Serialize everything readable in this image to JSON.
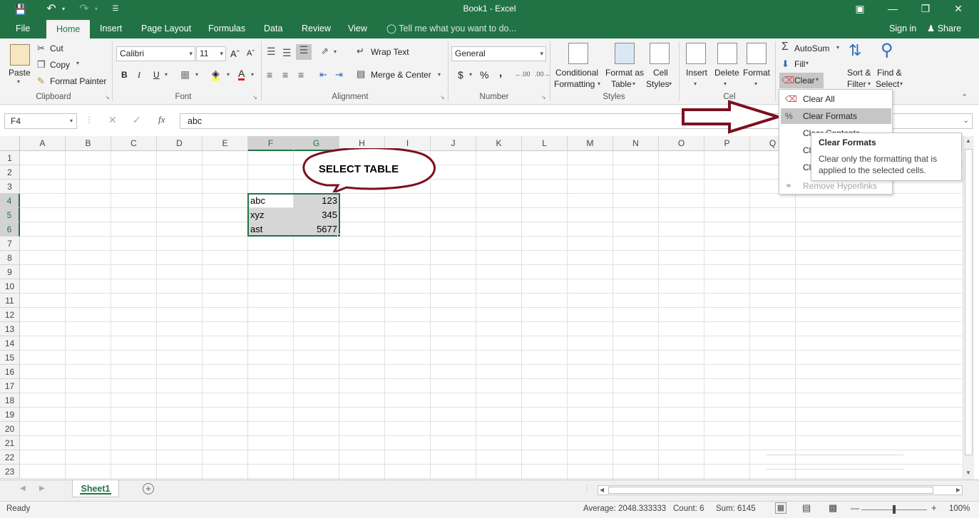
{
  "window": {
    "title": "Book1  -  Excel",
    "undo_icon": "undo-icon",
    "redo_icon": "redo-icon",
    "save_icon": "save-icon"
  },
  "tabs": [
    "File",
    "Home",
    "Insert",
    "Page Layout",
    "Formulas",
    "Data",
    "Review",
    "View"
  ],
  "active_tab": "Home",
  "tell_me": "Tell me what you want to do...",
  "account": {
    "sign_in": "Sign in",
    "share": "Share"
  },
  "ribbon": {
    "clipboard": {
      "paste": "Paste",
      "cut": "Cut",
      "copy": "Copy",
      "format_painter": "Format Painter",
      "label": "Clipboard"
    },
    "font": {
      "name": "Calibri",
      "size": "11",
      "bold": "B",
      "italic": "I",
      "underline": "U",
      "label": "Font"
    },
    "alignment": {
      "wrap_text": "Wrap Text",
      "merge_center": "Merge & Center",
      "label": "Alignment"
    },
    "number": {
      "format": "General",
      "currency": "$",
      "percent": "%",
      "comma": ",",
      "label": "Number"
    },
    "styles": {
      "conditional_1": "Conditional",
      "conditional_2": "Formatting",
      "format_table_1": "Format as",
      "format_table_2": "Table",
      "cell_styles_1": "Cell",
      "cell_styles_2": "Styles",
      "label": "Styles"
    },
    "cells": {
      "insert": "Insert",
      "delete": "Delete",
      "format": "Format",
      "label": "Cells"
    },
    "editing": {
      "autosum": "AutoSum",
      "fill": "Fill",
      "clear": "Clear",
      "sort_1": "Sort &",
      "sort_2": "Filter",
      "find_1": "Find &",
      "find_2": "Select"
    }
  },
  "formula_bar": {
    "name_box": "F4",
    "fx": "fx",
    "value": "abc"
  },
  "columns": [
    "A",
    "B",
    "C",
    "D",
    "E",
    "F",
    "G",
    "H",
    "I",
    "J",
    "K",
    "L",
    "M",
    "N",
    "O",
    "P",
    "Q"
  ],
  "selected_columns": [
    "F",
    "G"
  ],
  "rows": [
    "1",
    "2",
    "3",
    "4",
    "5",
    "6",
    "7",
    "8",
    "9",
    "10",
    "11",
    "12",
    "13",
    "14",
    "15",
    "16",
    "17",
    "18",
    "19",
    "20",
    "21",
    "22",
    "23"
  ],
  "selected_rows": [
    "4",
    "5",
    "6"
  ],
  "table": [
    {
      "text": "abc",
      "value": "123"
    },
    {
      "text": "xyz",
      "value": "345"
    },
    {
      "text": "ast",
      "value": "5677"
    }
  ],
  "callout": {
    "text": "SELECT TABLE",
    "color": "#7b1020"
  },
  "clear_menu": [
    {
      "label": "Clear All",
      "icon": "eraser-icon",
      "state": "normal"
    },
    {
      "label": "Clear Formats",
      "icon": "clear-formats-icon",
      "state": "hover"
    },
    {
      "label": "Clear Contents",
      "icon": "",
      "state": "normal"
    },
    {
      "label": "Cl",
      "icon": "",
      "state": "normal"
    },
    {
      "label": "Cl",
      "icon": "",
      "state": "normal"
    },
    {
      "label": "Remove Hyperlinks",
      "icon": "unlink-icon",
      "state": "disabled"
    }
  ],
  "tooltip": {
    "title": "Clear Formats",
    "body": "Clear only the formatting that is applied to the selected cells."
  },
  "sheets": [
    "Sheet1"
  ],
  "status": {
    "mode": "Ready",
    "average": "Average: 2048.333333",
    "count": "Count: 6",
    "sum": "Sum: 6145",
    "zoom": "100%"
  },
  "colors": {
    "excel_green": "#217346",
    "arrow": "#7b1020"
  }
}
